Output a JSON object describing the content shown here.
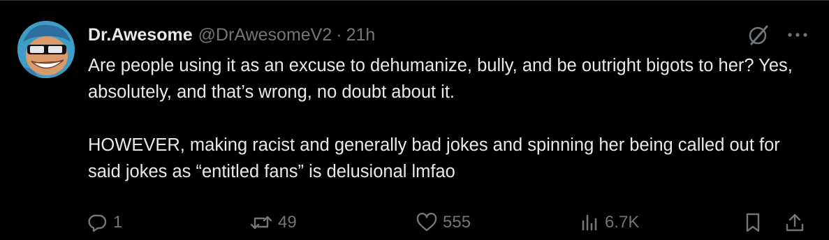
{
  "tweet": {
    "author_name": "Dr.Awesome",
    "handle": "@DrAwesomeV2",
    "separator": "·",
    "time": "21h",
    "text": "Are people using it as an excuse to dehumanize, bully, and be outright bigots to her? Yes, absolutely, and that’s wrong, no doubt about it.\n\nHOWEVER, making racist and generally bad jokes and spinning her being called out for said jokes as “entitled fans” is delusional lmfao"
  },
  "actions": {
    "replies": "1",
    "reposts": "49",
    "likes": "555",
    "views": "6.7K"
  },
  "icons": {
    "avatar": "avatar-image",
    "grok": "grok-icon",
    "more": "more-icon",
    "reply": "reply-icon",
    "repost": "repost-icon",
    "like": "heart-icon",
    "views": "views-icon",
    "bookmark": "bookmark-icon",
    "share": "share-icon"
  },
  "colors": {
    "background": "#000000",
    "text": "#e7e9ea",
    "secondary": "#71767b",
    "border": "#2f3336"
  }
}
